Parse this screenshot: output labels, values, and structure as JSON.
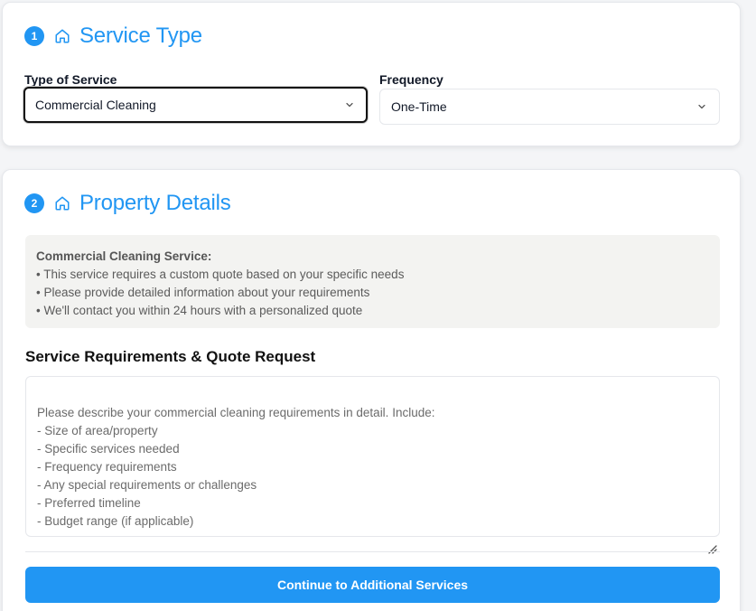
{
  "service_type": {
    "step_number": "1",
    "title": "Service Type",
    "type_of_service": {
      "label": "Type of Service",
      "value": "Commercial Cleaning"
    },
    "frequency": {
      "label": "Frequency",
      "value": "One-Time"
    }
  },
  "property_details": {
    "step_number": "2",
    "title": "Property Details",
    "info": {
      "title": "Commercial Cleaning Service:",
      "lines": [
        "• This service requires a custom quote based on your specific needs",
        "• Please provide detailed information about your requirements",
        "• We'll contact you within 24 hours with a personalized quote"
      ]
    },
    "requirements_heading": "Service Requirements & Quote Request",
    "textarea_placeholder": "Please describe your commercial cleaning requirements in detail. Include:\n- Size of area/property\n- Specific services needed\n- Frequency requirements\n- Any special requirements or challenges\n- Preferred timeline\n- Budget range (if applicable)",
    "continue_label": "Continue to Additional Services"
  },
  "colors": {
    "accent": "#2196f3",
    "info_bg": "#f3f3f1"
  },
  "icons": {
    "section": "home-icon",
    "select": "chevron-down-icon"
  }
}
